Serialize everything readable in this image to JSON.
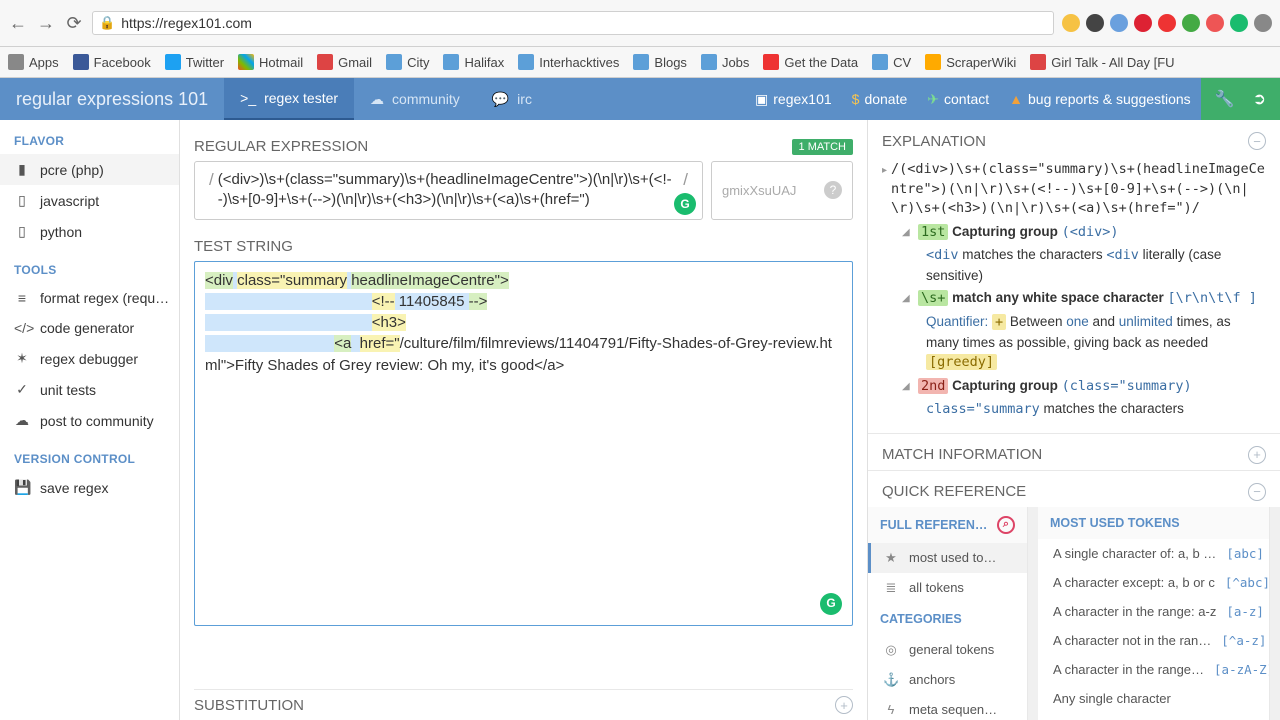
{
  "browser": {
    "url_scheme": "https://",
    "url_host": "regex101.com",
    "bookmarks": [
      "Apps",
      "Facebook",
      "Twitter",
      "Hotmail",
      "Gmail",
      "City",
      "Halifax",
      "Interhacktives",
      "Blogs",
      "Jobs",
      "Get the Data",
      "CV",
      "ScraperWiki",
      "Girl Talk - All Day [FU"
    ]
  },
  "brand": {
    "first": "regular",
    "second": " expressions ",
    "third": "101"
  },
  "tabs": {
    "tester": "regex tester",
    "community": "community",
    "irc": "irc"
  },
  "toplinks": {
    "regex101": "regex101",
    "donate": "donate",
    "contact": "contact",
    "bugs": "bug reports & suggestions"
  },
  "sidebar": {
    "flavor_head": "FLAVOR",
    "flavors": [
      "pcre (php)",
      "javascript",
      "python"
    ],
    "tools_head": "TOOLS",
    "tools": [
      "format regex (requ…",
      "code generator",
      "regex debugger",
      "unit tests",
      "post to community"
    ],
    "vc_head": "VERSION CONTROL",
    "vc": [
      "save regex"
    ]
  },
  "headers": {
    "regex": "REGULAR EXPRESSION",
    "test": "TEST STRING",
    "sub": "SUBSTITUTION",
    "explain": "EXPLANATION",
    "matchinfo": "MATCH INFORMATION",
    "quickref": "QUICK REFERENCE"
  },
  "match_badge": "1 MATCH",
  "regex_pattern": "(<div>)\\s+(class=\"summary)\\s+(headlineImageCentre\">)(\\n|\\r)\\s+(<!--)\\s+[0-9]+\\s+(-->)(\\n|\\r)\\s+(<h3>)(\\n|\\r)\\s+(<a)\\s+(href=\")",
  "flags_placeholder": "gmixXsuUAJ",
  "test_string": {
    "l1a": "<div",
    "l1b": " ",
    "l1c": "class=\"summary",
    "l1d": " ",
    "l1e": "headlineImageCentre\">",
    "l2a": "<!--",
    "l2b": " 11405845 ",
    "l2c": "-->",
    "l3a": "<h3>",
    "l4a": "<a",
    "l4b": "  ",
    "l4c": "href=\"",
    "rest": "/culture/film/filmreviews/11404791/Fifty-Shades-of-Grey-review.html\">Fifty Shades of Grey review: Oh my, it's good</a>"
  },
  "explain_text": {
    "full_regex": "/(<div>)\\s+(class=\"summary)\\s+(headlineImageCentre\">)(\\n|\\r)\\s+(<!--)\\s+[0-9]+\\s+(-->)(\\n|\\r)\\s+(<h3>)(\\n|\\r)\\s+(<a)\\s+(href=\")/",
    "g1_label": "1st",
    "g1_text": " Capturing group ",
    "g1_code": "(<div>)",
    "g1_lit1": "<div",
    "g1_lit2": " matches the characters ",
    "g1_lit3": "<div",
    "g1_lit4": " literally (case sensitive)",
    "ws_label": "\\s+",
    "ws_text": " match any white space character ",
    "ws_code": "[\\r\\n\\t\\f ]",
    "q_label": "Quantifier: ",
    "q_plus": "+",
    "q_between": " Between ",
    "q_one": "one",
    "q_and": " and ",
    "q_unl": "unlimited",
    "q_times": " times, as many times as possible, giving back as needed ",
    "q_greedy": "[greedy]",
    "g2_label": "2nd",
    "g2_text": " Capturing group ",
    "g2_code": "(class=\"summary)",
    "g2_lit1": "class=\"summary",
    "g2_lit2": " matches the characters"
  },
  "quickref": {
    "left_head": "FULL REFEREN…",
    "left_items": [
      "most used to…",
      "all tokens"
    ],
    "cat_head": "CATEGORIES",
    "cats": [
      "general tokens",
      "anchors",
      "meta sequen…"
    ],
    "right_head": "MOST USED TOKENS",
    "right_items": [
      {
        "desc": "A single character of: a, b …",
        "tok": "[abc]"
      },
      {
        "desc": "A character except: a, b or c",
        "tok": "[^abc]"
      },
      {
        "desc": "A character in the range: a-z",
        "tok": "[a-z]"
      },
      {
        "desc": "A character not in the ran…",
        "tok": "[^a-z]"
      },
      {
        "desc": "A character in the range…",
        "tok": "[a-zA-Z]"
      },
      {
        "desc": "Any single character",
        "tok": ""
      }
    ]
  }
}
